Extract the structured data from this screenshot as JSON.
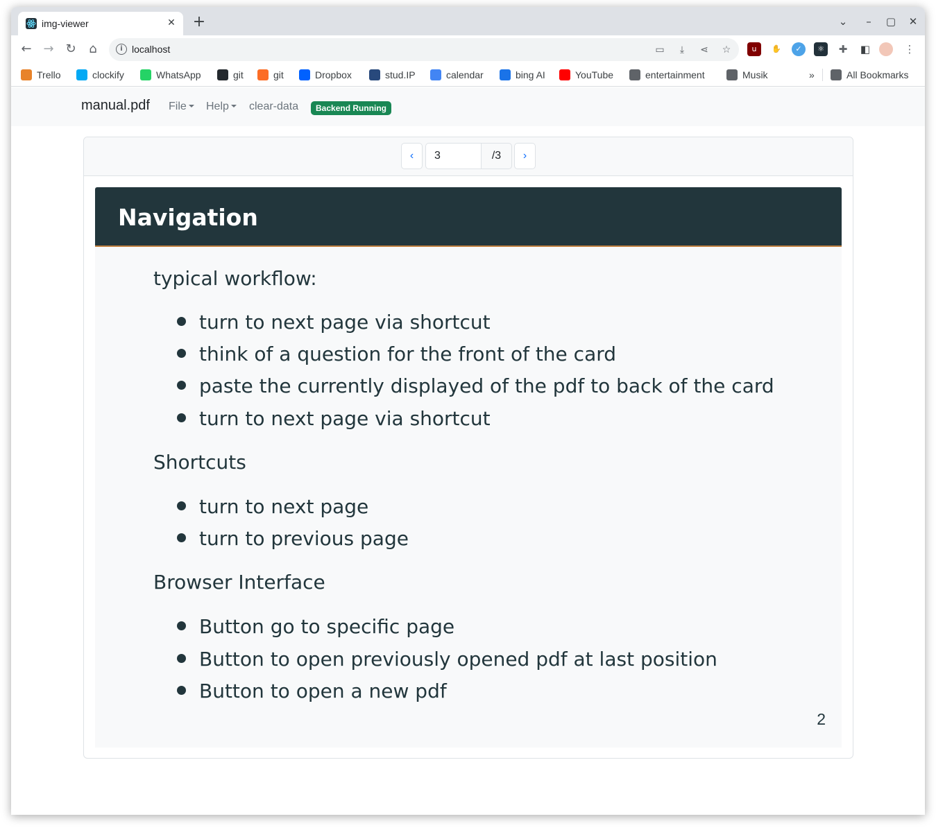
{
  "browser": {
    "tab_title": "img-viewer",
    "url": "localhost",
    "bookmarks": [
      {
        "label": "Trello",
        "icon": "trello-icon",
        "color": "#e8832a"
      },
      {
        "label": "clockify",
        "icon": "clockify-icon",
        "color": "#03a9f4"
      },
      {
        "label": "WhatsApp",
        "icon": "whatsapp-icon",
        "color": "#25d366"
      },
      {
        "label": "git",
        "icon": "github-icon",
        "color": "#24292e"
      },
      {
        "label": "git",
        "icon": "gitlab-icon",
        "color": "#fc6d26"
      },
      {
        "label": "Dropbox",
        "icon": "dropbox-icon",
        "color": "#0061ff"
      },
      {
        "label": "stud.IP",
        "icon": "studip-icon",
        "color": "#28497c"
      },
      {
        "label": "calendar",
        "icon": "calendar-icon",
        "color": "#4285f4"
      },
      {
        "label": "bing AI",
        "icon": "search-icon",
        "color": "#1a73e8"
      },
      {
        "label": "YouTube",
        "icon": "youtube-icon",
        "color": "#ff0000"
      },
      {
        "label": "entertainment",
        "icon": "folder-icon",
        "color": "#5f6368"
      },
      {
        "label": "Musik",
        "icon": "folder-icon",
        "color": "#5f6368"
      }
    ],
    "overflow_label": "»",
    "all_bookmarks": "All Bookmarks"
  },
  "app": {
    "brand": "manual.pdf",
    "menu_file": "File",
    "menu_help": "Help",
    "clear_data": "clear-data",
    "badge": "Backend Running",
    "badge_color": "#198754"
  },
  "pager": {
    "prev": "‹",
    "current": "3",
    "total": "/3",
    "next": "›"
  },
  "slide": {
    "title": "Navigation",
    "sections": [
      {
        "heading": "typical workflow:",
        "items": [
          "turn to next page via shortcut",
          "think of a question for the front of the card",
          "paste the currently displayed of the pdf to back of the card",
          "turn to next page via shortcut"
        ]
      },
      {
        "heading": "Shortcuts",
        "items": [
          "turn to next page",
          "turn to previous page"
        ]
      },
      {
        "heading": "Browser Interface",
        "items": [
          "Button go to specific page",
          "Button to open previously opened pdf at last position",
          "Button to open a new pdf"
        ]
      }
    ],
    "page_number": "2"
  }
}
